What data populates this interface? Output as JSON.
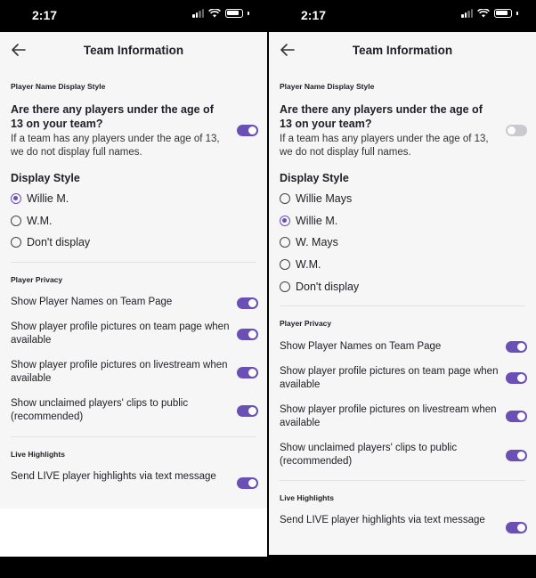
{
  "colors": {
    "accent": "#6a4fb5",
    "background": "#f6f6f7",
    "toggle_off": "#c9c9cf"
  },
  "left": {
    "status": {
      "time": "2:17"
    },
    "header": {
      "title": "Team Information",
      "back_icon": "arrow-left-icon"
    },
    "name_section": {
      "label": "Player Name Display Style",
      "question": "Are there any players under the age of 13 on your team?",
      "description": "If a team has any players under the age of 13, we do not display full names.",
      "under13_on": true,
      "display_label": "Display Style",
      "options": [
        "Willie M.",
        "W.M.",
        "Don't display"
      ],
      "selected": "Willie M."
    },
    "privacy": {
      "label": "Player Privacy",
      "rows": [
        {
          "text": "Show Player Names on Team Page",
          "on": true
        },
        {
          "text": "Show player profile pictures on team page when available",
          "on": true
        },
        {
          "text": "Show player profile pictures on livestream when available",
          "on": true
        },
        {
          "text": "Show unclaimed players' clips to public (recommended)",
          "on": true
        }
      ]
    },
    "highlights": {
      "label": "Live Highlights",
      "rows": [
        {
          "text": "Send LIVE player highlights via text message",
          "on": true
        }
      ]
    }
  },
  "right": {
    "status": {
      "time": "2:17"
    },
    "header": {
      "title": "Team Information",
      "back_icon": "arrow-left-icon"
    },
    "name_section": {
      "label": "Player Name Display Style",
      "question": "Are there any players under the age of 13 on your team?",
      "description": "If a team has any players under the age of 13, we do not display full names.",
      "under13_on": false,
      "display_label": "Display Style",
      "options": [
        "Willie Mays",
        "Willie M.",
        "W. Mays",
        "W.M.",
        "Don't display"
      ],
      "selected": "Willie M."
    },
    "privacy": {
      "label": "Player Privacy",
      "rows": [
        {
          "text": "Show Player Names on Team Page",
          "on": true
        },
        {
          "text": "Show player profile pictures on team page when available",
          "on": true
        },
        {
          "text": "Show player profile pictures on livestream when available",
          "on": true
        },
        {
          "text": "Show unclaimed players' clips to public (recommended)",
          "on": true
        }
      ]
    },
    "highlights": {
      "label": "Live Highlights",
      "rows": [
        {
          "text": "Send LIVE player highlights via text message",
          "on": true
        }
      ]
    }
  }
}
